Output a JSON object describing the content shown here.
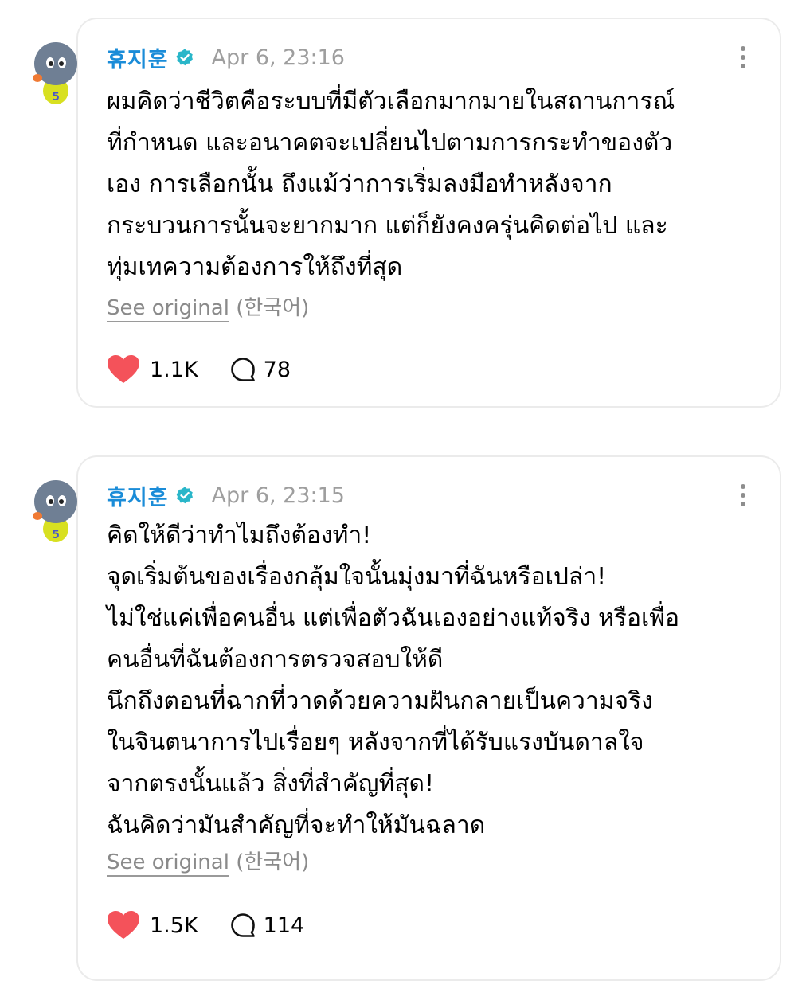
{
  "posts": [
    {
      "author": "휴지훈",
      "timestamp": "Apr 6, 23:16",
      "lines": [
        "ผมคิดว่าชีวิตคือระบบที่มีตัวเลือกมากมายในสถานการณ์",
        "ที่กำหนด และอนาคตจะเปลี่ยนไปตามการกระทำของตัว",
        "เอง การเลือกนั้น ถึงแม้ว่าการเริ่มลงมือทำหลังจาก",
        "กระบวนการนั้นจะยากมาก แต่ก็ยังคงครุ่นคิดต่อไป และ",
        "ทุ่มเทความต้องการให้ถึงที่สุด"
      ],
      "see_original": "See original",
      "language": "(한국어)",
      "likes": "1.1K",
      "replies": "78"
    },
    {
      "author": "휴지훈",
      "timestamp": "Apr 6, 23:15",
      "lines": [
        "คิดให้ดีว่าทำไมถึงต้องทำ!",
        "จุดเริ่มต้นของเรื่องกลุ้มใจนั้นมุ่งมาที่ฉันหรือเปล่า!",
        "ไม่ใช่แค่เพื่อคนอื่น แต่เพื่อตัวฉันเองอย่างแท้จริง หรือเพื่อ",
        "คนอื่นที่ฉันต้องการตรวจสอบให้ดี",
        "นึกถึงตอนที่ฉากที่วาดด้วยความฝันกลายเป็นความจริง",
        "ในจินตนาการไปเรื่อยๆ หลังจากที่ได้รับแรงบันดาลใจ",
        "จากตรงนั้นแล้ว สิ่งที่สำคัญที่สุด!",
        "ฉันคิดว่ามันสำคัญที่จะทำให้มันฉลาด"
      ],
      "see_original": "See original",
      "language": "(한국어)",
      "likes": "1.5K",
      "replies": "114"
    }
  ],
  "colors": {
    "author": "#1a8cd8",
    "verified": "#29b6c9",
    "like": "#f4525a",
    "muted": "#9e9e9e"
  },
  "icons": {
    "avatar": "cartoon-bird-avatar",
    "verified": "verified-badge-icon",
    "more": "more-options-icon",
    "like": "heart-icon",
    "reply": "comment-bubble-icon"
  }
}
